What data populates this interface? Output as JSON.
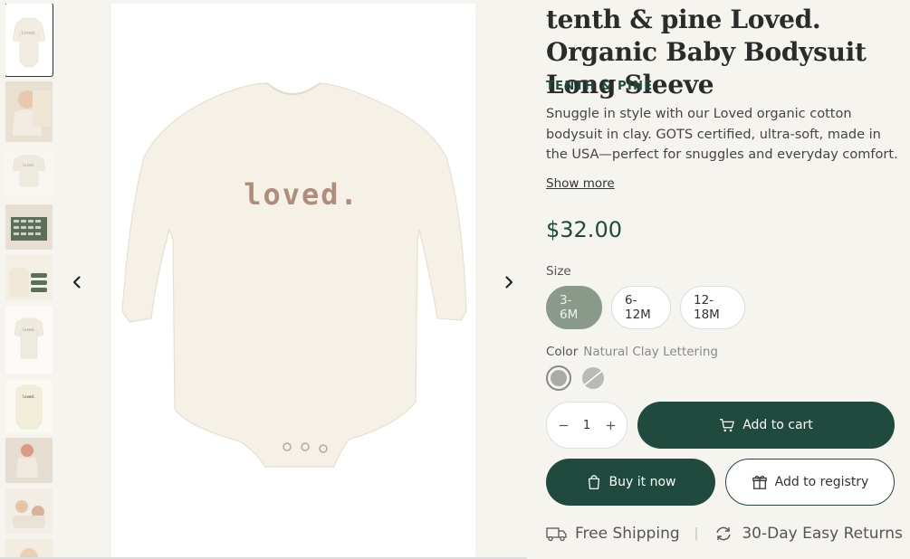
{
  "gallery": {
    "thumbnails": [
      "thumbnail-1",
      "thumbnail-2",
      "thumbnail-3",
      "thumbnail-4",
      "thumbnail-5",
      "thumbnail-6",
      "thumbnail-7",
      "thumbnail-8",
      "thumbnail-9",
      "thumbnail-10"
    ],
    "prev_icon": "chevron-left-icon",
    "next_icon": "chevron-right-icon",
    "main_image_text": "loved."
  },
  "product": {
    "title": "tenth & pine Loved. Organic Baby Bodysuit Long Sleeve",
    "brand": "TENTH & PINE",
    "description": "Snuggle in style with our Loved organic cotton bodysuit in clay. GOTS certified, ultra-soft, made in the USA—perfect for snuggles and everyday comfort.",
    "show_more": "Show more",
    "price": "$32.00",
    "size_label": "Size",
    "sizes": [
      "3-6M",
      "6-12M",
      "12-18M"
    ],
    "selected_size": "3-6M",
    "color_label": "Color",
    "color_value": "Natural Clay Lettering",
    "swatches": [
      {
        "name": "natural-clay",
        "color": "#a9a9a6"
      },
      {
        "name": "alternate",
        "color": "#b9b9b6"
      }
    ],
    "quantity": "1",
    "add_to_cart": "Add to cart",
    "buy_now": "Buy it now",
    "add_to_registry": "Add to registry",
    "perks": {
      "shipping": "Free Shipping",
      "separator": "|",
      "returns": "30-Day Easy Returns"
    }
  },
  "colors": {
    "brand_green": "#1f4a3d",
    "size_selected": "#8a9a8a",
    "background": "#f6f4ef"
  }
}
